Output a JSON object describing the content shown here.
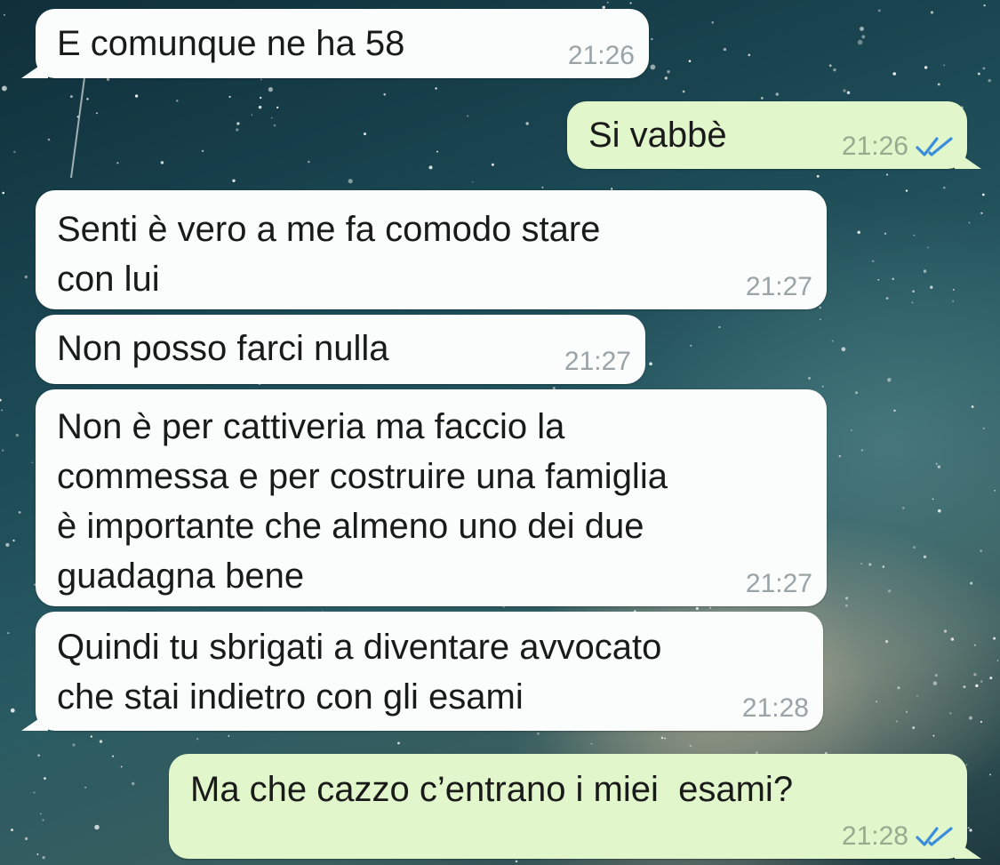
{
  "messages": [
    {
      "direction": "incoming",
      "text": "E comunque ne ha 58",
      "time": "21:26"
    },
    {
      "direction": "outgoing",
      "text": "Si vabbè",
      "time": "21:26",
      "status": "read-double-check-icon"
    },
    {
      "direction": "incoming",
      "text": "Senti è vero a me fa comodo stare\ncon lui",
      "time": "21:27"
    },
    {
      "direction": "incoming",
      "text": "Non posso farci nulla",
      "time": "21:27"
    },
    {
      "direction": "incoming",
      "text": "Non è per cattiveria ma faccio la\ncommessa e per costruire una famiglia\nè importante che almeno uno dei due\nguadagna bene",
      "time": "21:27"
    },
    {
      "direction": "incoming",
      "text": "Quindi tu sbrigati a diventare avvocato\nche stai indietro con gli esami",
      "time": "21:28"
    },
    {
      "direction": "outgoing",
      "text": "Ma che cazzo c’entrano i miei  esami?",
      "time": "21:28",
      "status": "read-double-check-icon"
    }
  ],
  "colors": {
    "incoming_bubble": "#fbfcfc",
    "outgoing_bubble": "#e1f6cb",
    "read_ticks": "#3a8ddb"
  }
}
